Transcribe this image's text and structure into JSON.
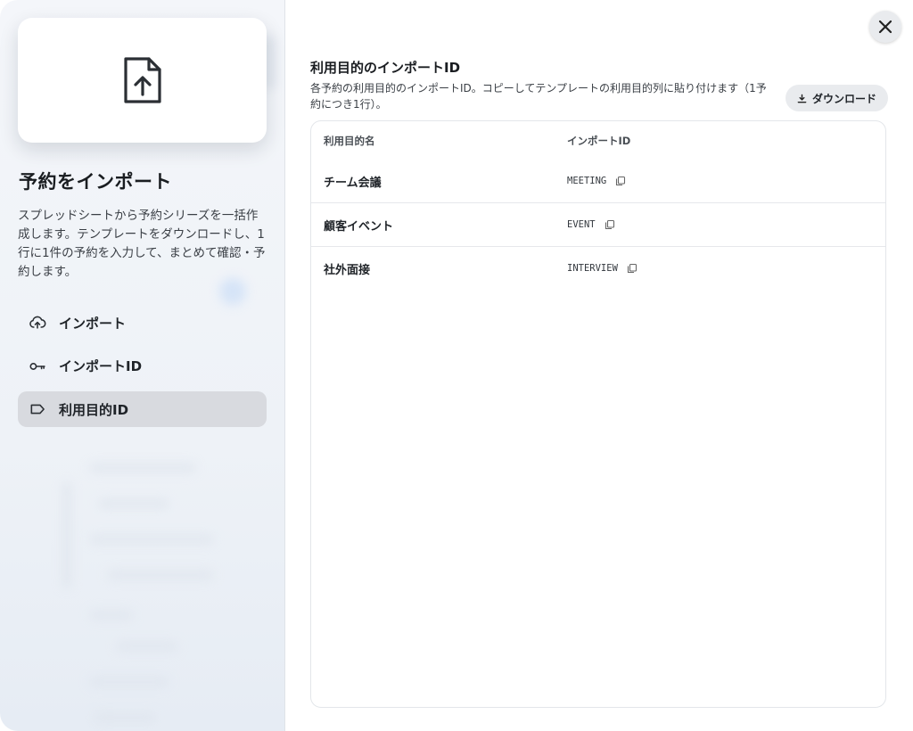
{
  "sidebar": {
    "title": "予約をインポート",
    "description": "スプレッドシートから予約シリーズを一括作成します。テンプレートをダウンロードし、1行に1件の予約を入力して、まとめて確認・予約します。",
    "hero_icon": "file-upload-icon",
    "items": [
      {
        "label": "インポート",
        "icon": "cloud-upload-icon",
        "active": false
      },
      {
        "label": "インポートID",
        "icon": "key-icon",
        "active": false
      },
      {
        "label": "利用目的ID",
        "icon": "tag-icon",
        "active": true
      }
    ]
  },
  "main": {
    "title": "利用目的のインポートID",
    "description": "各予約の利用目的のインポートID。コピーしてテンプレートの利用目的列に貼り付けます（1予約につき1行）。",
    "download_label": "ダウンロード",
    "table": {
      "headers": [
        "利用目的名",
        "インポートID"
      ],
      "rows": [
        {
          "name": "チーム会議",
          "id": "MEETING"
        },
        {
          "name": "顧客イベント",
          "id": "EVENT"
        },
        {
          "name": "社外面接",
          "id": "INTERVIEW"
        }
      ]
    }
  },
  "colors": {
    "sidebar_bg": "#eef2f7",
    "active_item_bg": "#d8dadf",
    "button_bg": "#e9ebee",
    "text_primary": "#1f2328"
  }
}
